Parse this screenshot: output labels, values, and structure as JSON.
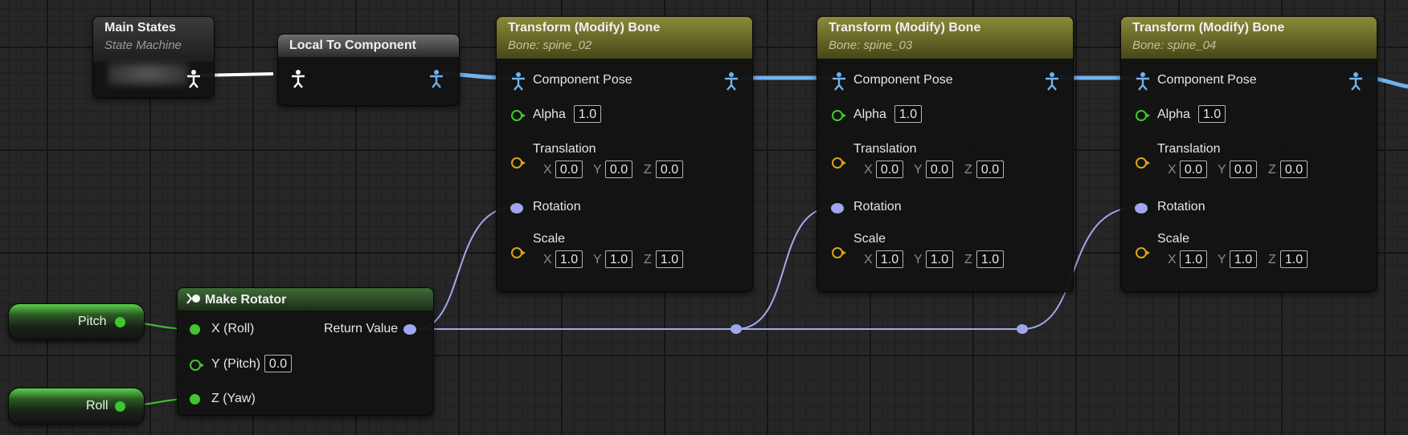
{
  "colors": {
    "pose_wire": "#6fb3ef",
    "rotator_wire": "#a3a9ee",
    "float_wire": "#3fc72e",
    "vector_pin": "#d7a51c",
    "exec_white": "#ffffff"
  },
  "icons": {
    "pose": "person-pose-icon",
    "make": "function-make-icon"
  },
  "main_states": {
    "title": "Main States",
    "subtitle": "State Machine"
  },
  "local_to_component": {
    "title": "Local To Component"
  },
  "transform_nodes": [
    {
      "title": "Transform (Modify) Bone",
      "bone": "Bone: spine_02",
      "pose_label": "Component Pose",
      "alpha_label": "Alpha",
      "alpha": "1.0",
      "translation_label": "Translation",
      "translation": {
        "x": "0.0",
        "y": "0.0",
        "z": "0.0"
      },
      "rotation_label": "Rotation",
      "scale_label": "Scale",
      "scale": {
        "x": "1.0",
        "y": "1.0",
        "z": "1.0"
      }
    },
    {
      "title": "Transform (Modify) Bone",
      "bone": "Bone: spine_03",
      "pose_label": "Component Pose",
      "alpha_label": "Alpha",
      "alpha": "1.0",
      "translation_label": "Translation",
      "translation": {
        "x": "0.0",
        "y": "0.0",
        "z": "0.0"
      },
      "rotation_label": "Rotation",
      "scale_label": "Scale",
      "scale": {
        "x": "1.0",
        "y": "1.0",
        "z": "1.0"
      }
    },
    {
      "title": "Transform (Modify) Bone",
      "bone": "Bone: spine_04",
      "pose_label": "Component Pose",
      "alpha_label": "Alpha",
      "alpha": "1.0",
      "translation_label": "Translation",
      "translation": {
        "x": "0.0",
        "y": "0.0",
        "z": "0.0"
      },
      "rotation_label": "Rotation",
      "scale_label": "Scale",
      "scale": {
        "x": "1.0",
        "y": "1.0",
        "z": "1.0"
      }
    }
  ],
  "axis_labels": {
    "x": "X",
    "y": "Y",
    "z": "Z"
  },
  "make_rotator": {
    "title": "Make Rotator",
    "x_label": "X (Roll)",
    "y_label": "Y (Pitch)",
    "y_value": "0.0",
    "z_label": "Z (Yaw)",
    "return_label": "Return Value"
  },
  "pitch_literal": {
    "label": "Pitch"
  },
  "roll_literal": {
    "label": "Roll"
  }
}
